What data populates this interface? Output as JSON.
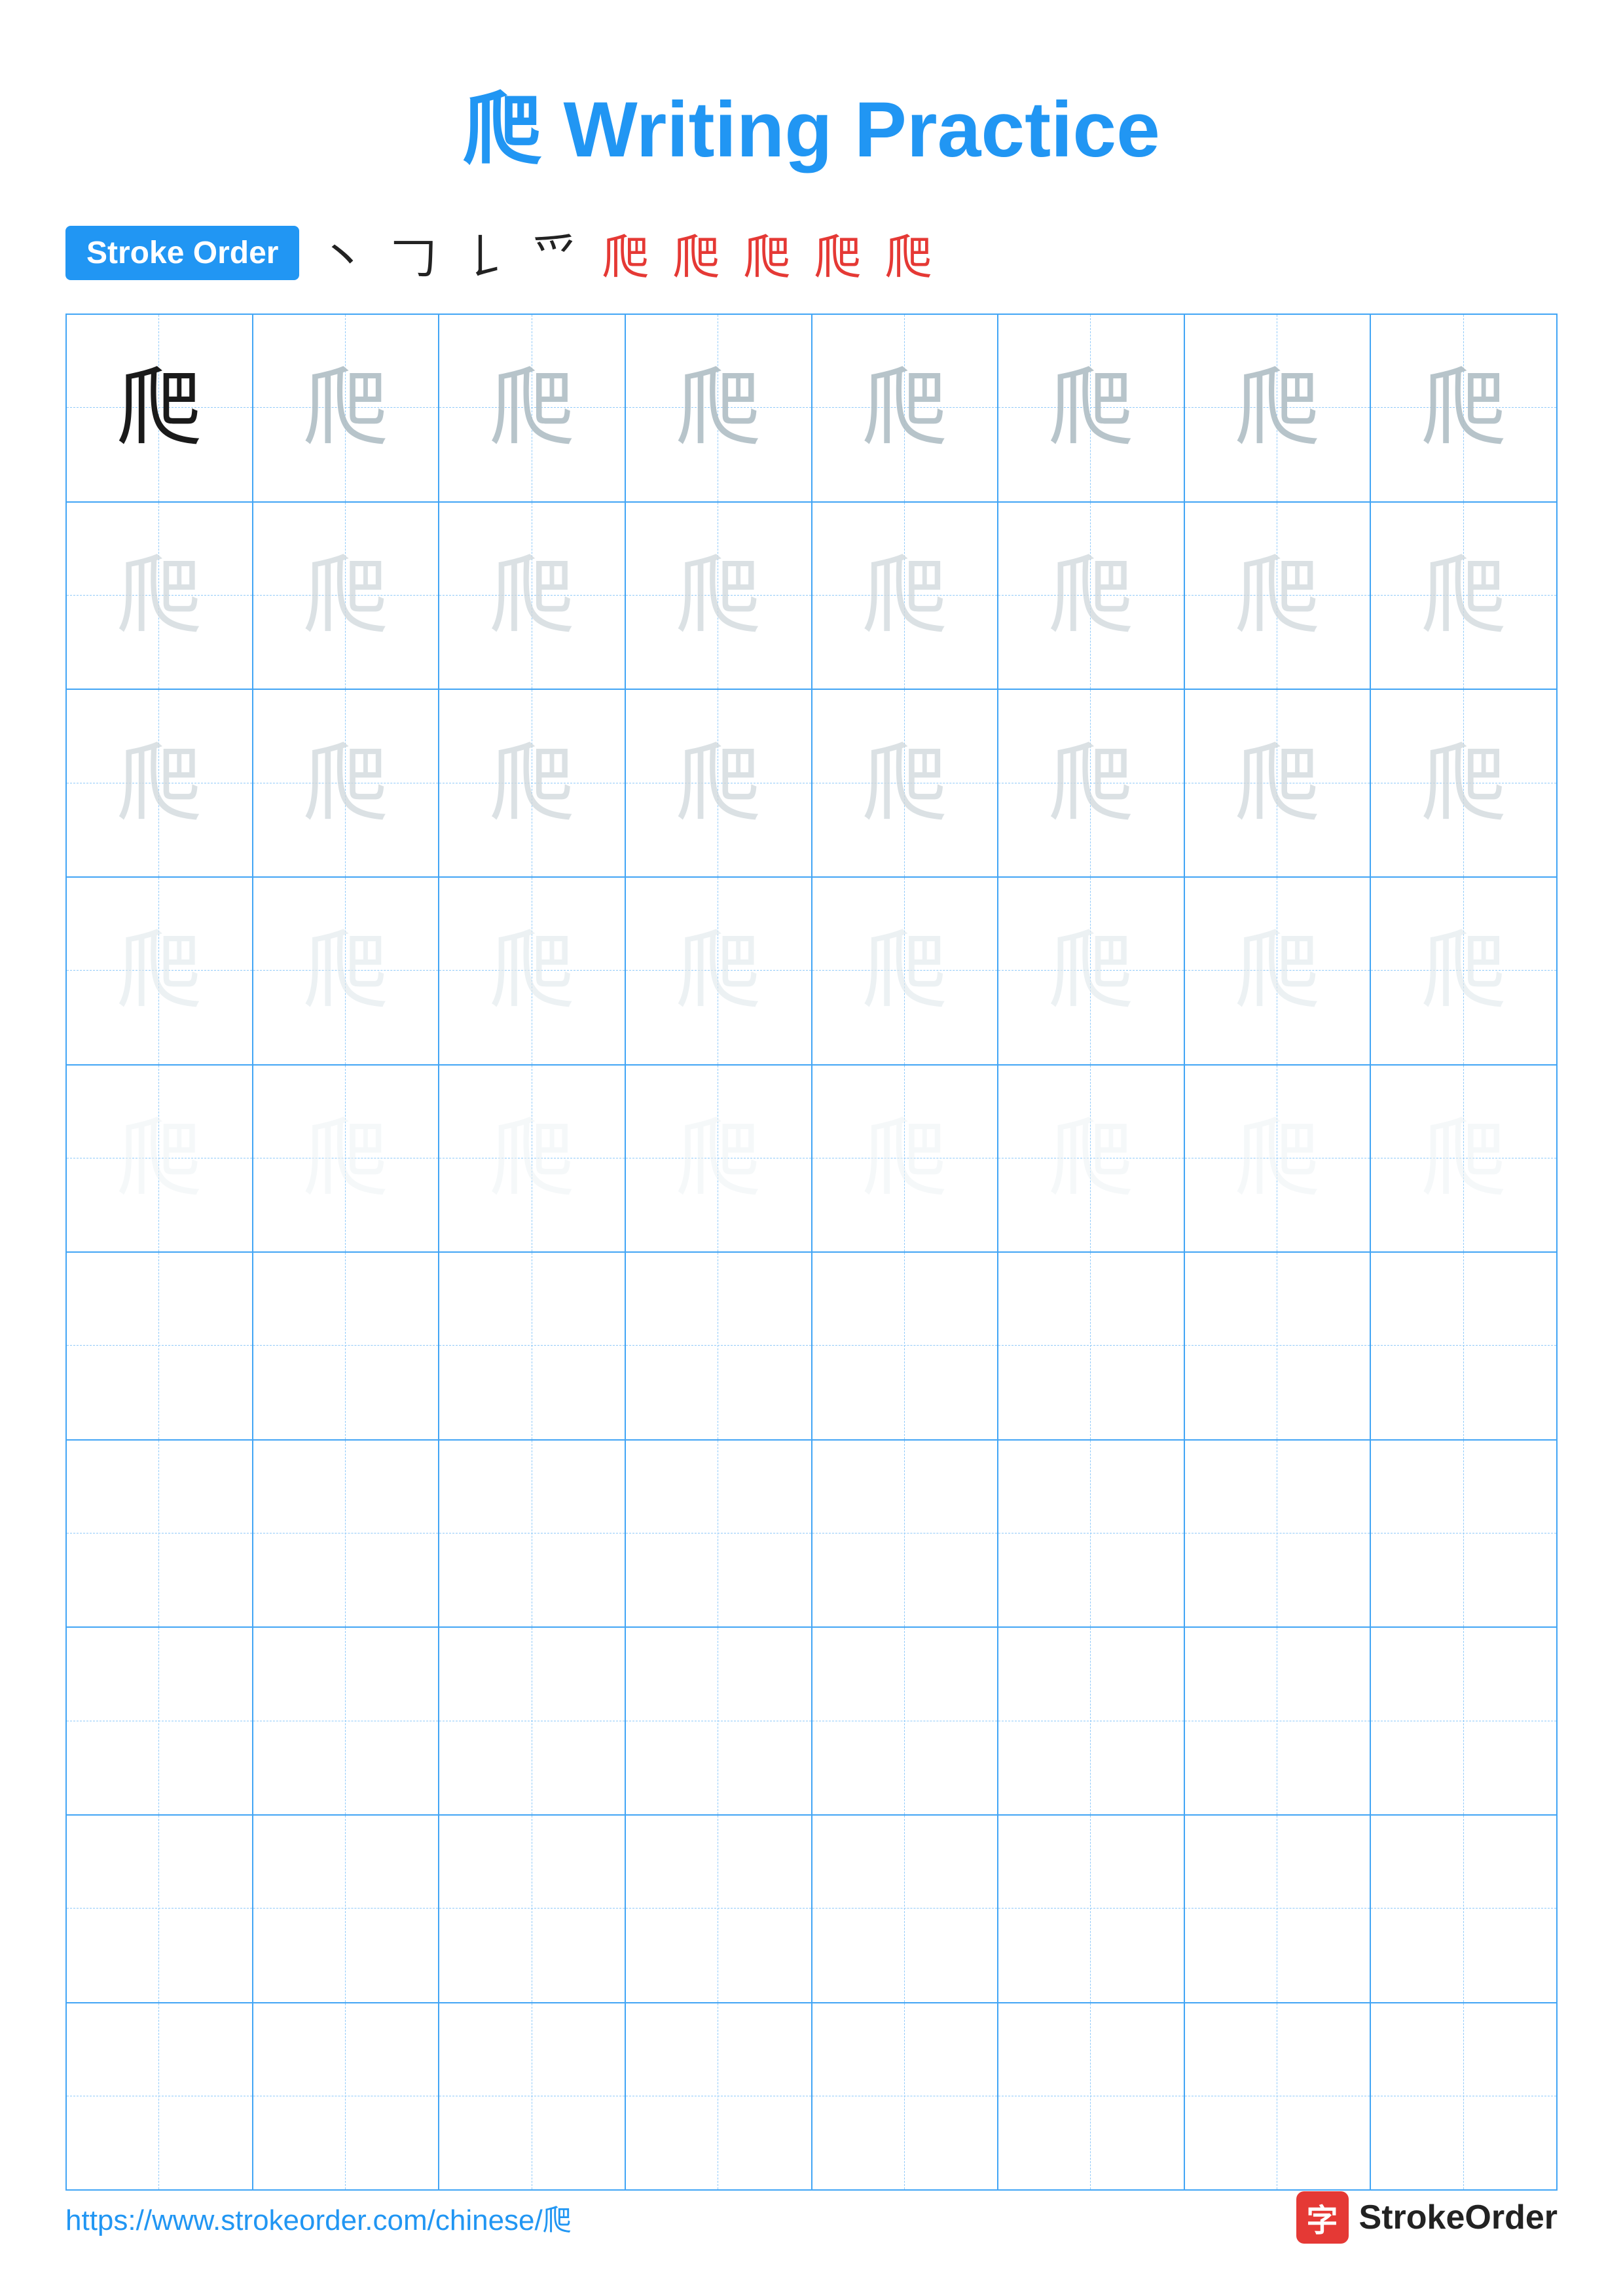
{
  "title": {
    "char": "爬",
    "label": "Writing Practice",
    "full": "爬 Writing Practice"
  },
  "stroke_order": {
    "badge_label": "Stroke Order",
    "strokes": [
      "丶",
      "𠃌",
      "𠄌",
      "爫",
      "爬⁴",
      "爬⁵",
      "爬⁶",
      "爬⁷",
      "爬"
    ]
  },
  "grid": {
    "rows": 10,
    "cols": 8,
    "char": "爬",
    "filled_rows": 5
  },
  "footer": {
    "url": "https://www.strokeorder.com/chinese/爬",
    "logo_text": "StrokeOrder",
    "logo_icon": "字"
  }
}
